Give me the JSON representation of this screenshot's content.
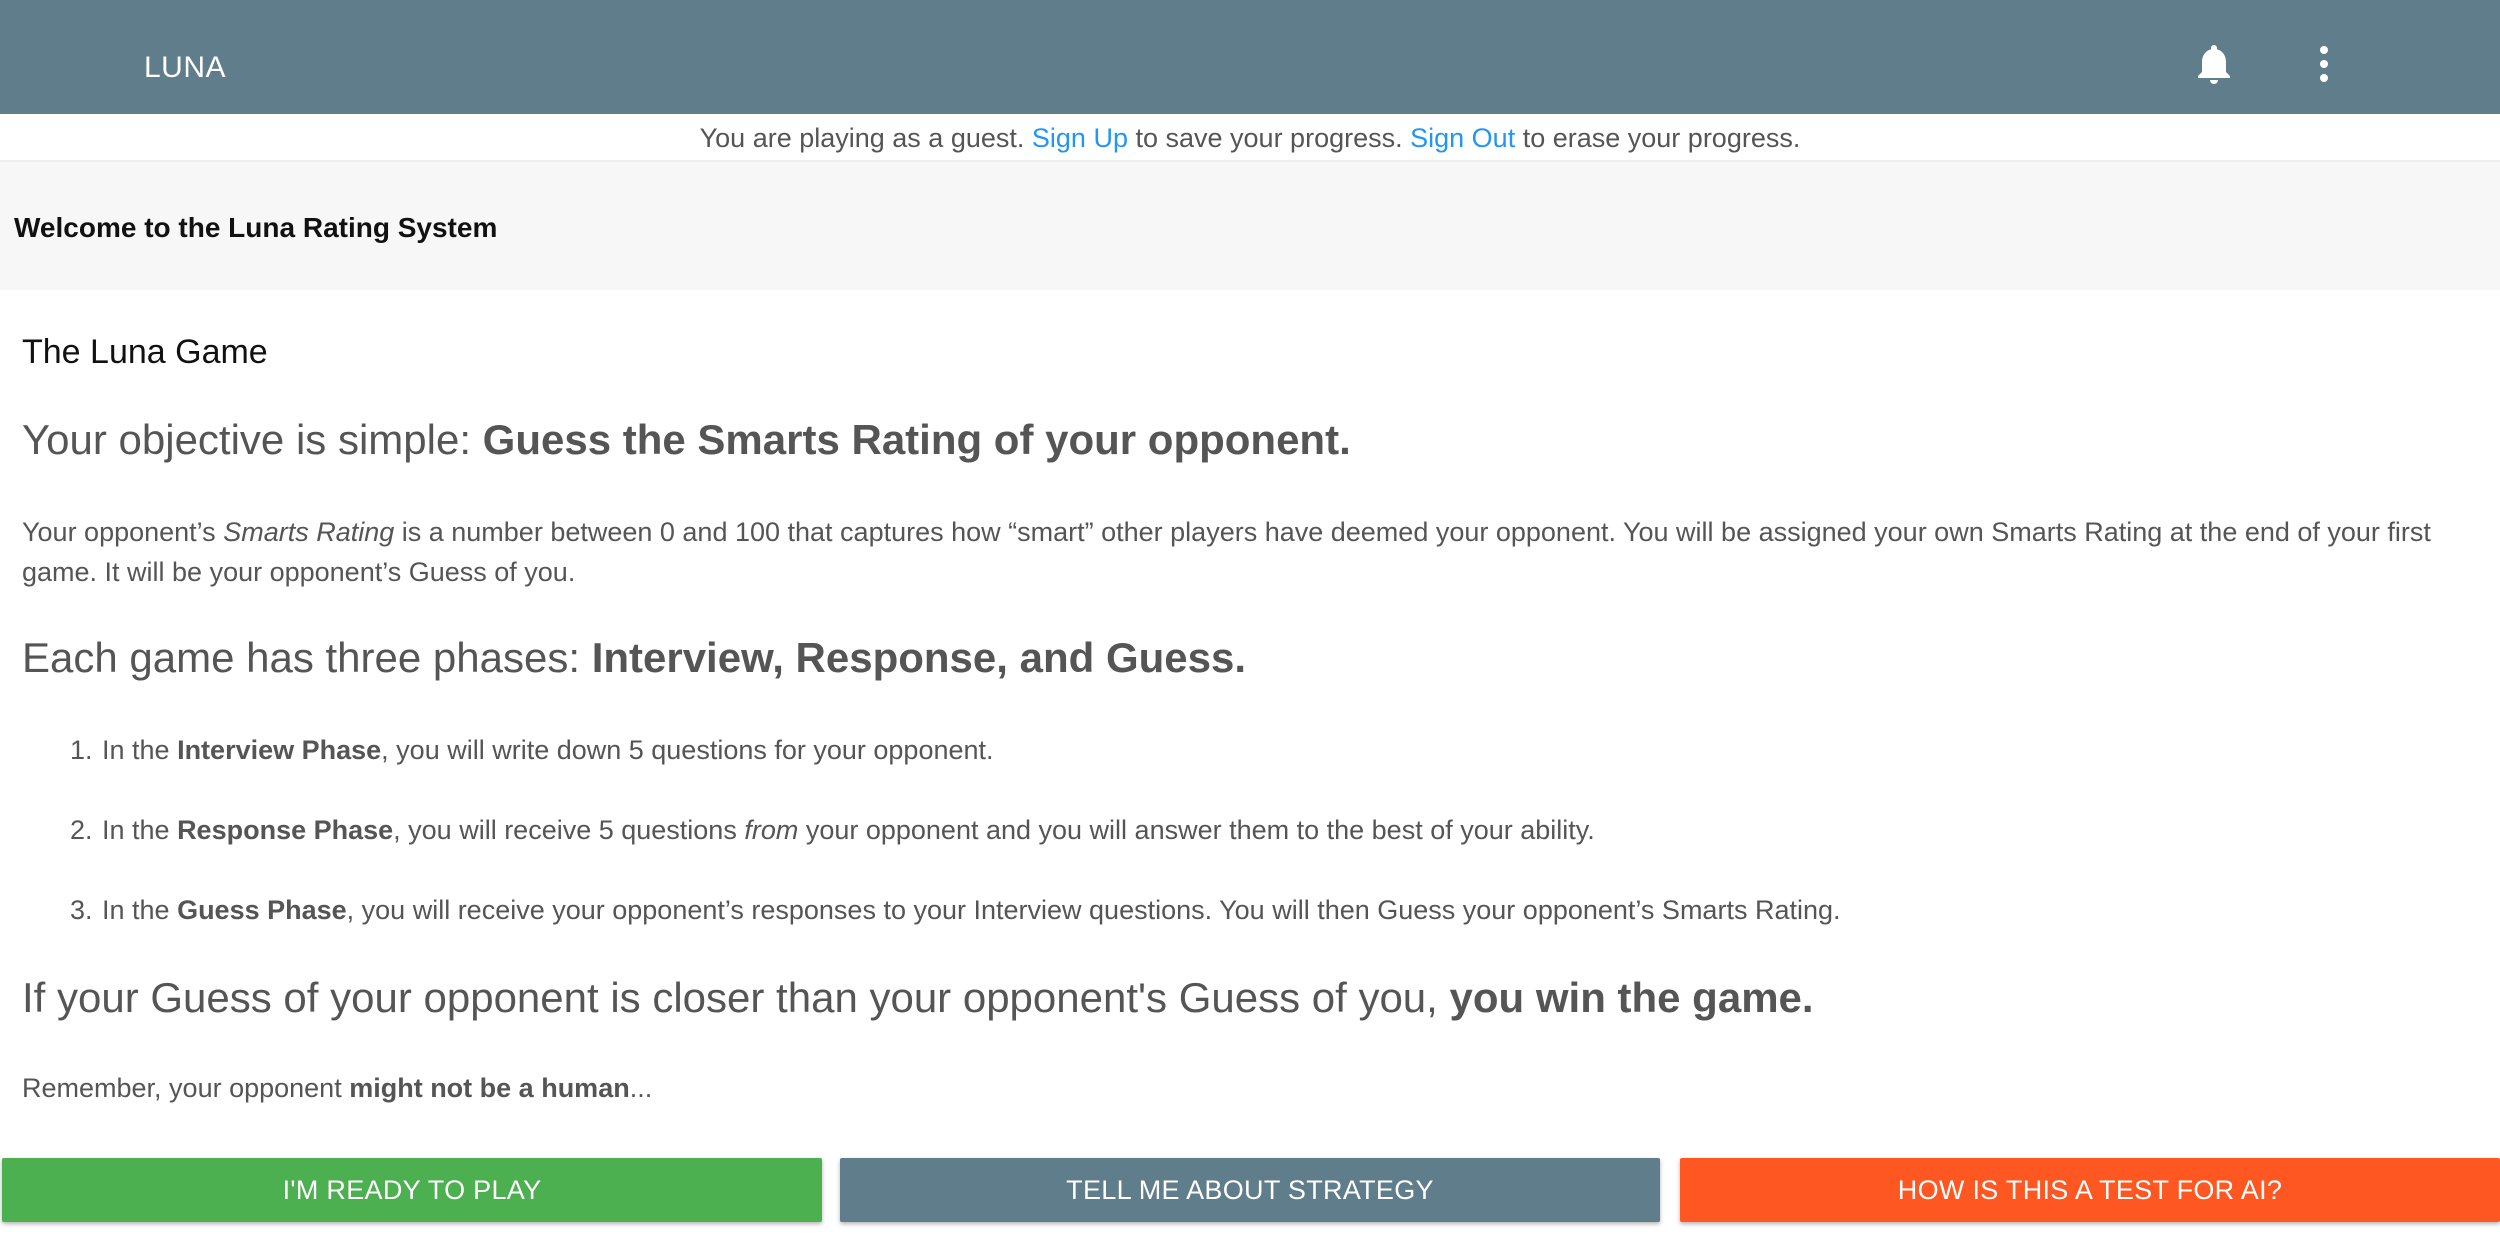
{
  "appbar": {
    "title": "LUNA",
    "bell_icon": "bell-icon",
    "menu_icon": "more-vert-icon",
    "background": "#607d8b"
  },
  "guest": {
    "part1": "You are playing as a guest.",
    "signup": "Sign Up",
    "part2": "to save your progress.",
    "signout": "Sign Out",
    "part3": "to erase your progress.",
    "link_color": "#2196f3"
  },
  "welcome": {
    "title": "Welcome to the Luna Rating System"
  },
  "game": {
    "section_title": "The Luna Game",
    "objective_prefix": "Your objective is simple: ",
    "objective_bold": "Guess the Smarts Rating of your opponent.",
    "rating_p1": "Your opponent’s ",
    "rating_em": "Smarts Rating",
    "rating_p2": " is a number between 0 and 100 that captures how “smart” other players have deemed your opponent. You will be assigned your own Smarts Rating at the end of your first game. It will be your opponent’s Guess of you.",
    "phases_prefix": "Each game has three phases: ",
    "phases_bold": "Interview, Response, and Guess.",
    "steps": [
      {
        "num": "1.",
        "pre": "In the ",
        "bold": "Interview Phase",
        "post": ", you will write down 5 questions for your opponent."
      },
      {
        "num": "2.",
        "pre": "In the ",
        "bold": "Response Phase",
        "mid": ", you will receive 5 questions ",
        "em": "from",
        "post": " your opponent and you will answer them to the best of your ability."
      },
      {
        "num": "3.",
        "pre": "In the ",
        "bold": "Guess Phase",
        "post": ", you will receive your opponent’s responses to your Interview questions. You will then Guess your opponent’s Smarts Rating."
      }
    ],
    "win_prefix": "If your Guess of your opponent is closer than your opponent's Guess of you, ",
    "win_bold": "you win the game.",
    "remember_pre": "Remember, your opponent ",
    "remember_bold": "might not be a human",
    "remember_post": "..."
  },
  "buttons": {
    "ready": "I'M READY TO PLAY",
    "strategy": "TELL ME ABOUT STRATEGY",
    "ai": "HOW IS THIS A TEST FOR AI?",
    "ready_color": "#4caf50",
    "strategy_color": "#607d8b",
    "ai_color": "#ff5722"
  }
}
